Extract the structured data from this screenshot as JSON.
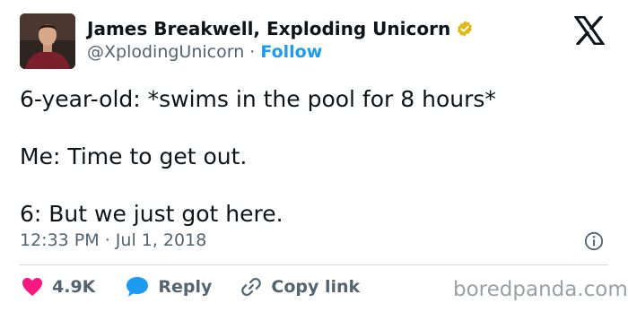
{
  "author": {
    "display_name": "James Breakwell, Exploding Unicorn",
    "handle": "@XplodingUnicorn",
    "separator": "·",
    "follow_label": "Follow",
    "verified": true
  },
  "tweet": {
    "lines": [
      "6-year-old: *swims in the pool for 8 hours*",
      "Me: Time to get out.",
      "6: But we just got here."
    ],
    "time": "12:33 PM",
    "separator": "·",
    "date": "Jul 1, 2018"
  },
  "actions": {
    "likes": "4.9K",
    "reply_label": "Reply",
    "copy_link_label": "Copy link"
  },
  "watermark": "boredpanda.com",
  "icons": {
    "verified": "verified-badge-icon",
    "platform": "x-logo-icon",
    "info": "info-icon",
    "like": "heart-icon",
    "reply": "speech-bubble-icon",
    "copy_link": "link-icon"
  },
  "colors": {
    "accent": "#1d9bf0",
    "like": "#f91880",
    "verified": "#e2b719",
    "text": "#0f1419",
    "muted": "#536471"
  }
}
